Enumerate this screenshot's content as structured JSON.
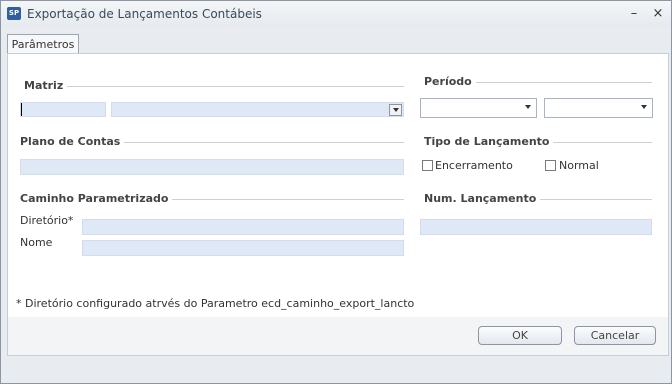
{
  "window": {
    "title": "Exportação de Lançamentos Contábeis",
    "app_icon": "SP",
    "minimize_glyph": "–",
    "close_glyph": "×"
  },
  "tabs": [
    {
      "label": "Parâmetros"
    }
  ],
  "sections": {
    "matriz": "Matriz",
    "periodo": "Período",
    "plano_contas": "Plano de Contas",
    "tipo_lancamento": "Tipo de Lançamento",
    "caminho": "Caminho Parametrizado",
    "num_lancamento": "Num. Lançamento"
  },
  "fields": {
    "diretorio_label": "Diretório*",
    "nome_label": "Nome",
    "matriz_code": "",
    "matriz_name": "",
    "periodo_inicio": "",
    "periodo_fim": "",
    "plano_contas": "",
    "diretorio": "",
    "nome": "",
    "num_lancamento": ""
  },
  "checkboxes": [
    {
      "label": "Encerramento",
      "checked": false
    },
    {
      "label": "Normal",
      "checked": false
    }
  ],
  "note": "* Diretório configurado atrvés do Parametro ecd_caminho_export_lancto",
  "buttons": {
    "ok": "OK",
    "cancel": "Cancelar"
  },
  "colors": {
    "field_bg": "#dfe8f6",
    "window_bg": "#e8ecf0",
    "accent": "#2f5f9e"
  }
}
